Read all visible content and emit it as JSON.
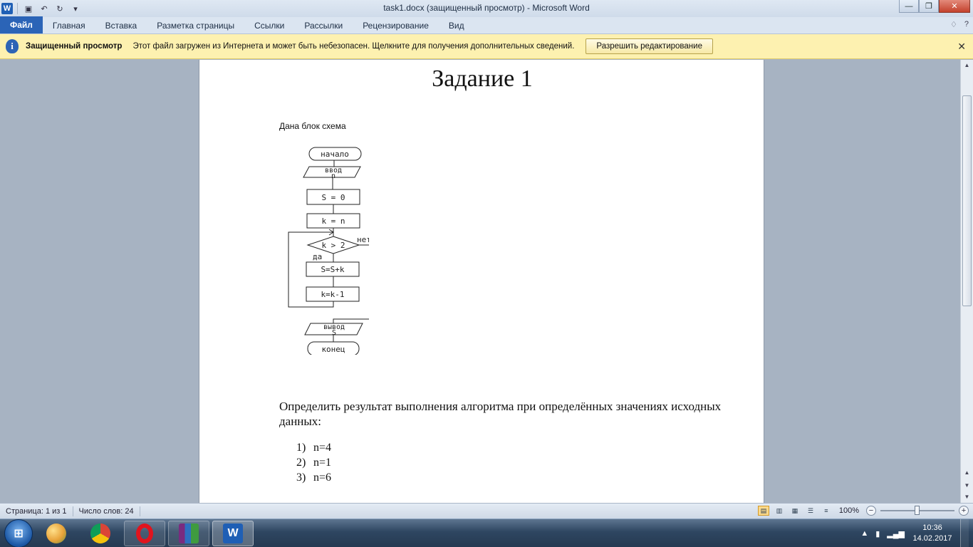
{
  "window": {
    "title": "task1.docx (защищенный просмотр)  -  Microsoft Word"
  },
  "ribbon": {
    "tabs": [
      "Файл",
      "Главная",
      "Вставка",
      "Разметка страницы",
      "Ссылки",
      "Рассылки",
      "Рецензирование",
      "Вид"
    ]
  },
  "protected_view": {
    "title": "Защищенный просмотр",
    "message": "Этот файл загружен из Интернета и может быть небезопасен. Щелкните для получения дополнительных сведений.",
    "button": "Разрешить редактирование"
  },
  "document": {
    "heading": "Задание 1",
    "intro": "Дана блок схема",
    "flowchart": {
      "start": "начало",
      "input_line1": "ввод",
      "input_line2": "n",
      "assign_s": "S = 0",
      "assign_k": "k = n",
      "condition": "k > 2",
      "no_label": "нет",
      "yes_label": "да",
      "step_sum": "S=S+k",
      "step_dec": "k=k-1",
      "output_line1": "вывод",
      "output_line2": "S",
      "end": "конец"
    },
    "question": "Определить результат выполнения алгоритма при определённых значениях исходных данных:",
    "answers": [
      {
        "num": "1)",
        "text": "n=4"
      },
      {
        "num": "2)",
        "text": "n=1"
      },
      {
        "num": "3)",
        "text": "n=6"
      }
    ]
  },
  "statusbar": {
    "page": "Страница: 1 из 1",
    "words": "Число слов: 24",
    "zoom": "100%",
    "zoom_level": 0.5
  },
  "taskbar": {
    "time": "10:36",
    "date": "14.02.2017"
  },
  "icons": {
    "word": "word-app-icon",
    "info": "info-icon",
    "close": "close-icon"
  },
  "colors": {
    "file_tab": "#2b64b7",
    "message_bar": "#fdf1b0"
  }
}
